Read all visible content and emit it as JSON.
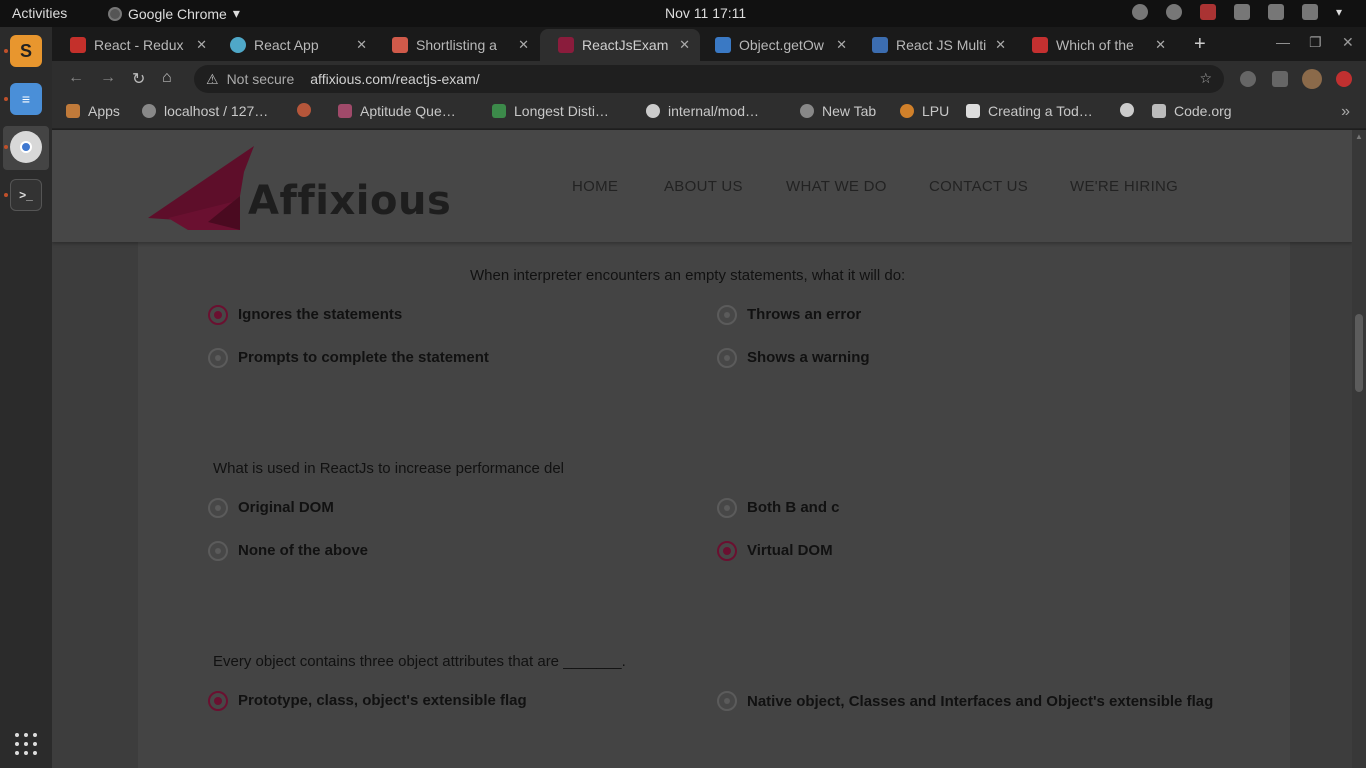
{
  "system": {
    "activities_label": "Activities",
    "app_menu_label": "Google Chrome",
    "clock": "Nov 11  17:11"
  },
  "browser": {
    "tabs": [
      {
        "title": "React - Redux",
        "favicon": "youtube-icon",
        "color": "#c4302b"
      },
      {
        "title": "React App",
        "favicon": "react-icon",
        "color": "#4fa8c8"
      },
      {
        "title": "Shortlisting a",
        "favicon": "gmail-icon",
        "color": "#d05a4a"
      },
      {
        "title": "ReactJsExam",
        "favicon": "affixious-icon",
        "color": "#8a1c3c"
      },
      {
        "title": "Object.getOw",
        "favicon": "mdn-icon",
        "color": "#3a79c4"
      },
      {
        "title": "React JS Multi",
        "favicon": "site-icon",
        "color": "#3c6db0"
      },
      {
        "title": "Which of the",
        "favicon": "site-icon",
        "color": "#c43030"
      }
    ],
    "omnibox": {
      "security_label": "Not secure",
      "url": "affixious.com/reactjs-exam/"
    },
    "bookmarks": [
      {
        "label": "Apps",
        "icon": "apps-grid-icon"
      },
      {
        "label": "localhost / 127…",
        "icon": "globe-icon"
      },
      {
        "label": "",
        "icon": "google-icon"
      },
      {
        "label": "Aptitude Que…",
        "icon": "site-icon"
      },
      {
        "label": "Longest Disti…",
        "icon": "gfg-icon"
      },
      {
        "label": "internal/mod…",
        "icon": "github-icon"
      },
      {
        "label": "New Tab",
        "icon": "globe-icon"
      },
      {
        "label": "LPU",
        "icon": "lpu-icon"
      },
      {
        "label": "Creating a Tod…",
        "icon": "video-icon"
      },
      {
        "label": "",
        "icon": "github-icon"
      },
      {
        "label": "Code.org",
        "icon": "code-org-icon"
      }
    ]
  },
  "site": {
    "logo_text": "Affixious",
    "brand_color": "#6a1030",
    "nav": [
      "HOME",
      "ABOUT US",
      "WHAT WE DO",
      "CONTACT US",
      "WE'RE HIRING"
    ]
  },
  "questions": [
    {
      "text": "When interpreter encounters an empty statements, what it will do:",
      "options": [
        {
          "label": "Ignores the statements",
          "checked": true
        },
        {
          "label": "Throws an error",
          "checked": false
        },
        {
          "label": "Prompts to complete the statement",
          "checked": false
        },
        {
          "label": "Shows a warning",
          "checked": false
        }
      ]
    },
    {
      "text": "What is used in ReactJs to increase performance del",
      "options": [
        {
          "label": "Original DOM",
          "checked": false
        },
        {
          "label": "Both B and c",
          "checked": false
        },
        {
          "label": "None of the above",
          "checked": false
        },
        {
          "label": "Virtual DOM",
          "checked": true
        }
      ]
    },
    {
      "text": "Every object contains three object attributes that are _______.",
      "options": [
        {
          "label": "Prototype, class, object's extensible flag",
          "checked": true
        },
        {
          "label": "Native object, Classes and Interfaces and Object's extensible flag",
          "checked": false
        }
      ]
    }
  ]
}
